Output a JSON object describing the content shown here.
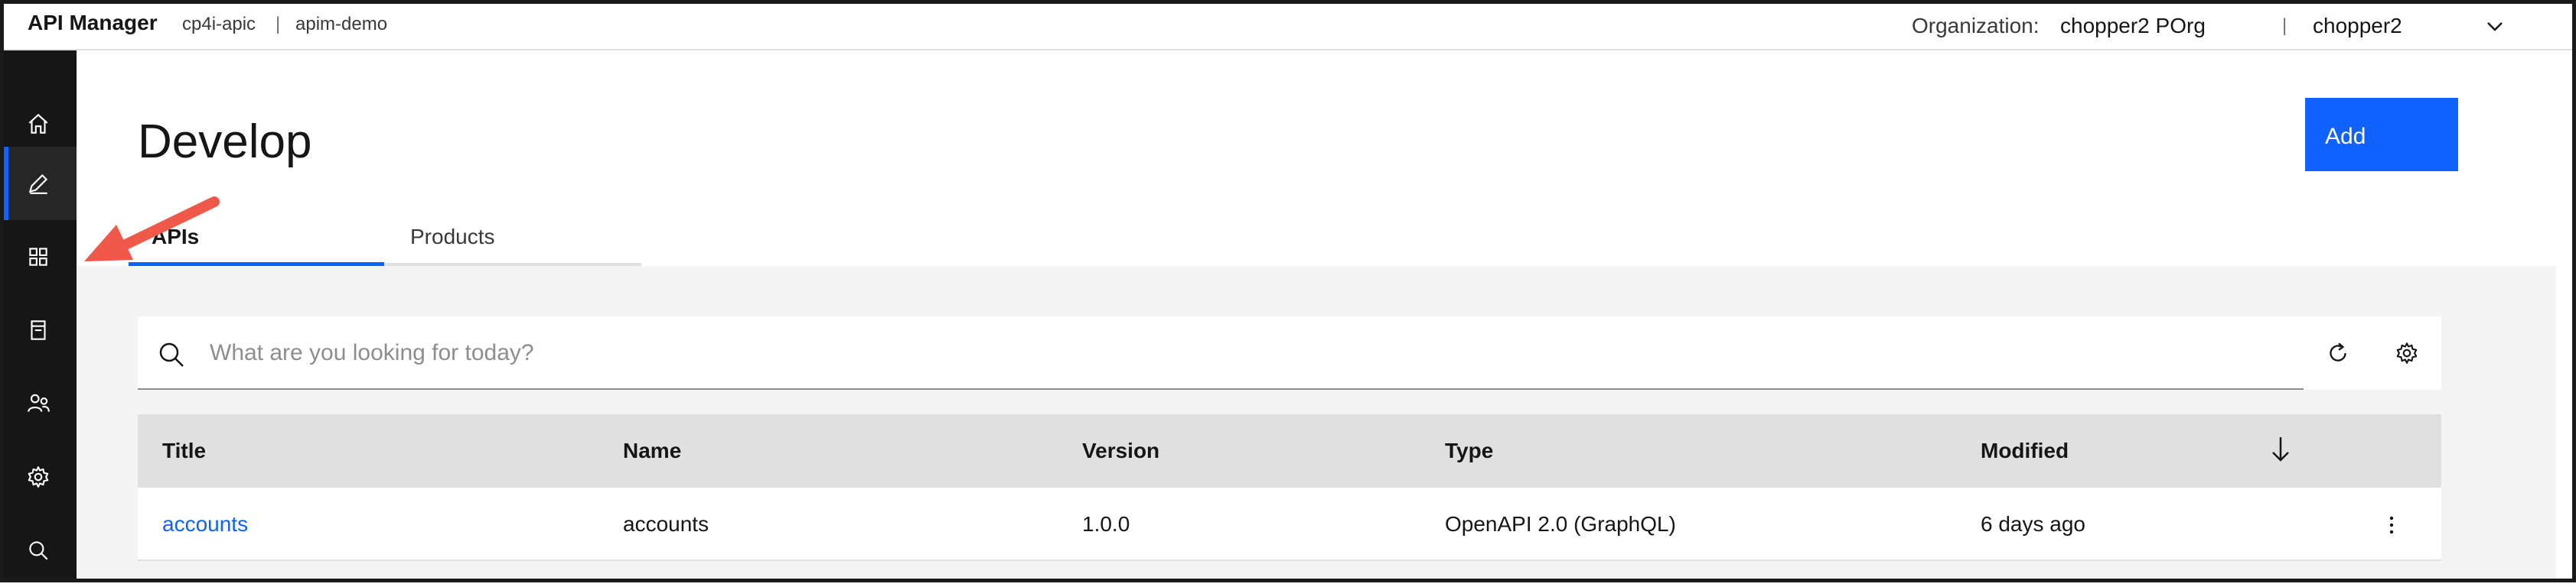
{
  "header": {
    "brand": "API Manager",
    "instance": "cp4i-apic",
    "separator": "|",
    "catalog": "apim-demo",
    "org_label": "Organization:",
    "org_value": "chopper2 POrg",
    "user_separator": "|",
    "user_value": "chopper2"
  },
  "sidenav": {
    "items": [
      {
        "icon": "home-icon"
      },
      {
        "icon": "edit-icon",
        "active": true
      },
      {
        "icon": "grid-icon"
      },
      {
        "icon": "catalog-icon"
      },
      {
        "icon": "members-icon"
      },
      {
        "icon": "settings-icon"
      },
      {
        "icon": "search-icon"
      }
    ]
  },
  "page": {
    "title": "Develop",
    "add_label": "Add",
    "tabs": [
      {
        "label": "APIs",
        "selected": true
      },
      {
        "label": "Products",
        "selected": false
      }
    ],
    "search_placeholder": "What are you looking for today?"
  },
  "table": {
    "columns": [
      "Title",
      "Name",
      "Version",
      "Type",
      "Modified"
    ],
    "rows": [
      {
        "title": "accounts",
        "name": "accounts",
        "version": "1.0.0",
        "type": "OpenAPI 2.0 (GraphQL)",
        "modified": "6 days ago"
      }
    ]
  },
  "colors": {
    "accent": "#0f62fe",
    "nav_bg": "#161616",
    "annotation_arrow": "#f0584a"
  }
}
